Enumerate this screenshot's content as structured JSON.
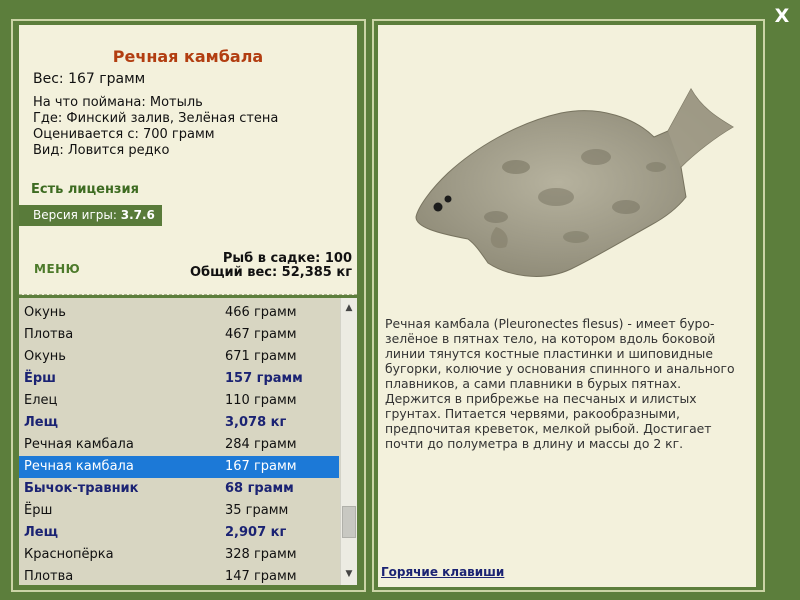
{
  "window": {
    "close_label": "X"
  },
  "info": {
    "title": "Речная камбала",
    "weight": "Вес: 167 грамм",
    "lines": [
      "На что поймана: Мотыль",
      "Где: Финский залив, Зелёная стена",
      "Оценивается с: 700 грамм",
      "Вид: Ловится редко"
    ],
    "license": "Есть лицензия",
    "version_label": "Версия игры: ",
    "version_number": "3.7.6",
    "menu_label": "МЕНЮ",
    "stats_count": "Рыб в садке: 100",
    "stats_weight": "Общий вес: 52,385 кг"
  },
  "catch_list": [
    {
      "name": "Окунь",
      "weight": "466 грамм",
      "bold": false,
      "selected": false
    },
    {
      "name": "Плотва",
      "weight": "467 грамм",
      "bold": false,
      "selected": false
    },
    {
      "name": "Окунь",
      "weight": "671 грамм",
      "bold": false,
      "selected": false
    },
    {
      "name": "Ёрш",
      "weight": "157 грамм",
      "bold": true,
      "selected": false
    },
    {
      "name": "Елец",
      "weight": "110 грамм",
      "bold": false,
      "selected": false
    },
    {
      "name": "Лещ",
      "weight": "3,078 кг",
      "bold": true,
      "selected": false
    },
    {
      "name": "Речная камбала",
      "weight": "284 грамм",
      "bold": false,
      "selected": false
    },
    {
      "name": "Речная камбала",
      "weight": "167 грамм",
      "bold": false,
      "selected": true
    },
    {
      "name": "Бычок-травник",
      "weight": "68 грамм",
      "bold": true,
      "selected": false
    },
    {
      "name": "Ёрш",
      "weight": "35 грамм",
      "bold": false,
      "selected": false
    },
    {
      "name": "Лещ",
      "weight": "2,907 кг",
      "bold": true,
      "selected": false
    },
    {
      "name": "Краснопёрка",
      "weight": "328 грамм",
      "bold": false,
      "selected": false
    },
    {
      "name": "Плотва",
      "weight": "147 грамм",
      "bold": false,
      "selected": false
    }
  ],
  "description": "Речная камбала (Pleuronectes flesus) - имеет буро-зелёное в пятнах тело, на котором вдоль боковой линии тянутся костные пластинки и шиповидные бугорки, колючие у основания спинного и анального плавников, а сами плавники в бурых пятнах. Держится в прибрежье на песчаных и илистых грунтах. Питается червями, ракообразными, предпочитая креветок, мелкой рыбой. Достигает почти до полуметра в длину и массы до 2 кг.",
  "hotkeys_label": "Горячие клавиши",
  "colors": {
    "background": "#5c7e3c",
    "panel": "#f3f1dc",
    "title": "#b23e11",
    "license": "#3d6b21",
    "bold_row": "#1b2373",
    "selected_row": "#1c79d7"
  },
  "icons": {
    "close": "close-icon",
    "scroll_up": "chevron-up-icon",
    "scroll_down": "chevron-down-icon"
  }
}
